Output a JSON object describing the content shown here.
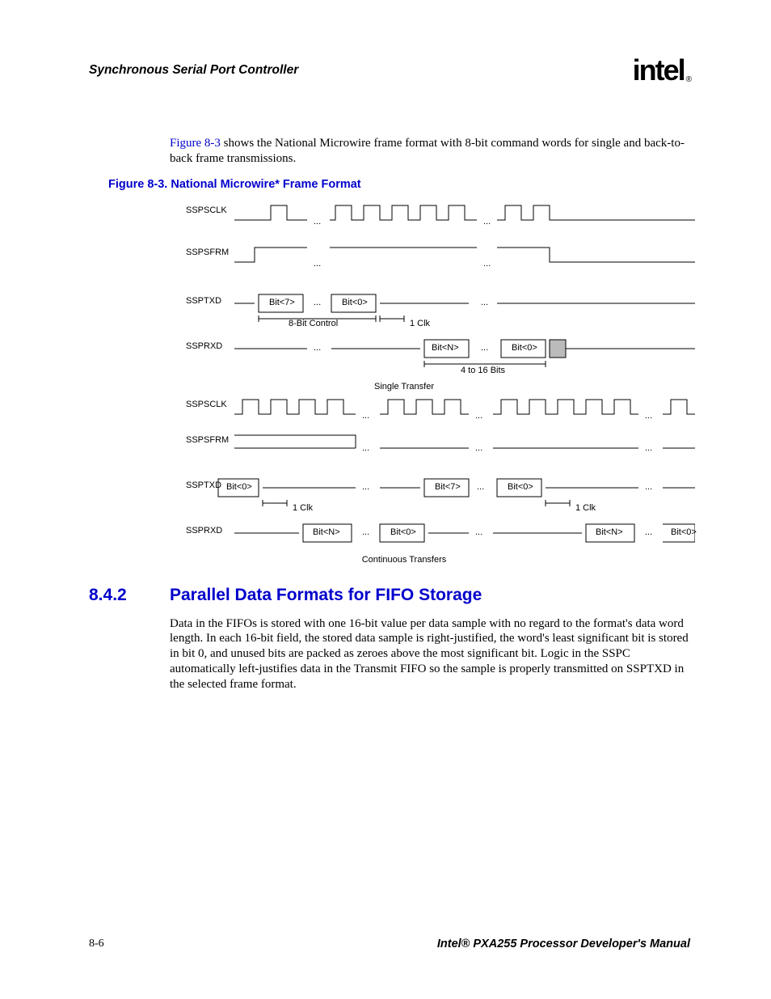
{
  "header": {
    "chapter_title": "Synchronous Serial Port Controller",
    "logo_text": "intel",
    "logo_reg": "®"
  },
  "intro": {
    "fig_ref": "Figure 8-3",
    "rest": " shows the National Microwire frame format with 8-bit command words for single and back-to-back frame transmissions."
  },
  "figure": {
    "caption": "Figure 8-3. National Microwire* Frame Format",
    "signals": {
      "sspsclk": "SSPSCLK",
      "sspsfrm": "SSPSFRM",
      "ssptxd": "SSPTXD",
      "ssprxd": "SSPRXD"
    },
    "labels": {
      "bit7": "Bit<7>",
      "bit0": "Bit<0>",
      "bitn": "Bit<N>",
      "eight_bit_control": "8-Bit Control",
      "one_clk": "1 Clk",
      "four_to_sixteen": "4 to 16 Bits",
      "single_transfer": "Single Transfer",
      "continuous_transfers": "Continuous Transfers",
      "dots": "..."
    }
  },
  "section": {
    "number": "8.4.2",
    "title": "Parallel Data Formats for FIFO Storage",
    "body": "Data in the FIFOs is stored with one 16-bit value per data sample with no regard to the format's data word length. In each 16-bit field, the stored data sample is right-justified, the word's least significant bit is stored in bit 0, and unused bits are packed as zeroes above the most significant bit. Logic in the SSPC automatically left-justifies data in the Transmit FIFO so the sample is properly transmitted on SSPTXD in the selected frame format."
  },
  "footer": {
    "page": "8-6",
    "manual": "Intel® PXA255 Processor Developer's Manual"
  }
}
